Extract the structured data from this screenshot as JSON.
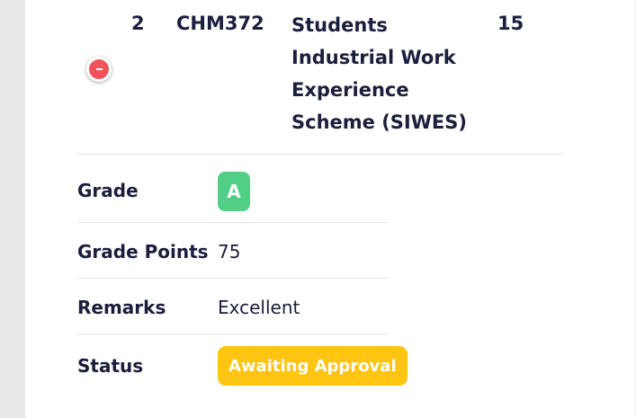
{
  "course_row": {
    "serial_number": "2",
    "course_code": "CHM372",
    "course_title": "Students Industrial Work Experience Scheme (SIWES)",
    "units": "15",
    "remove_button_icon": "minus-circle-icon"
  },
  "details": {
    "grade_label": "Grade",
    "grade_value": "A",
    "grade_points_label": "Grade Points",
    "grade_points_value": "75",
    "remarks_label": "Remarks",
    "remarks_value": "Excellent",
    "status_label": "Status",
    "status_value": "Awaiting Approval"
  },
  "colors": {
    "grade_badge": "#52cf86",
    "status_badge": "#ffc512",
    "remove_button": "#f1535a",
    "text": "#1b1e3d"
  }
}
